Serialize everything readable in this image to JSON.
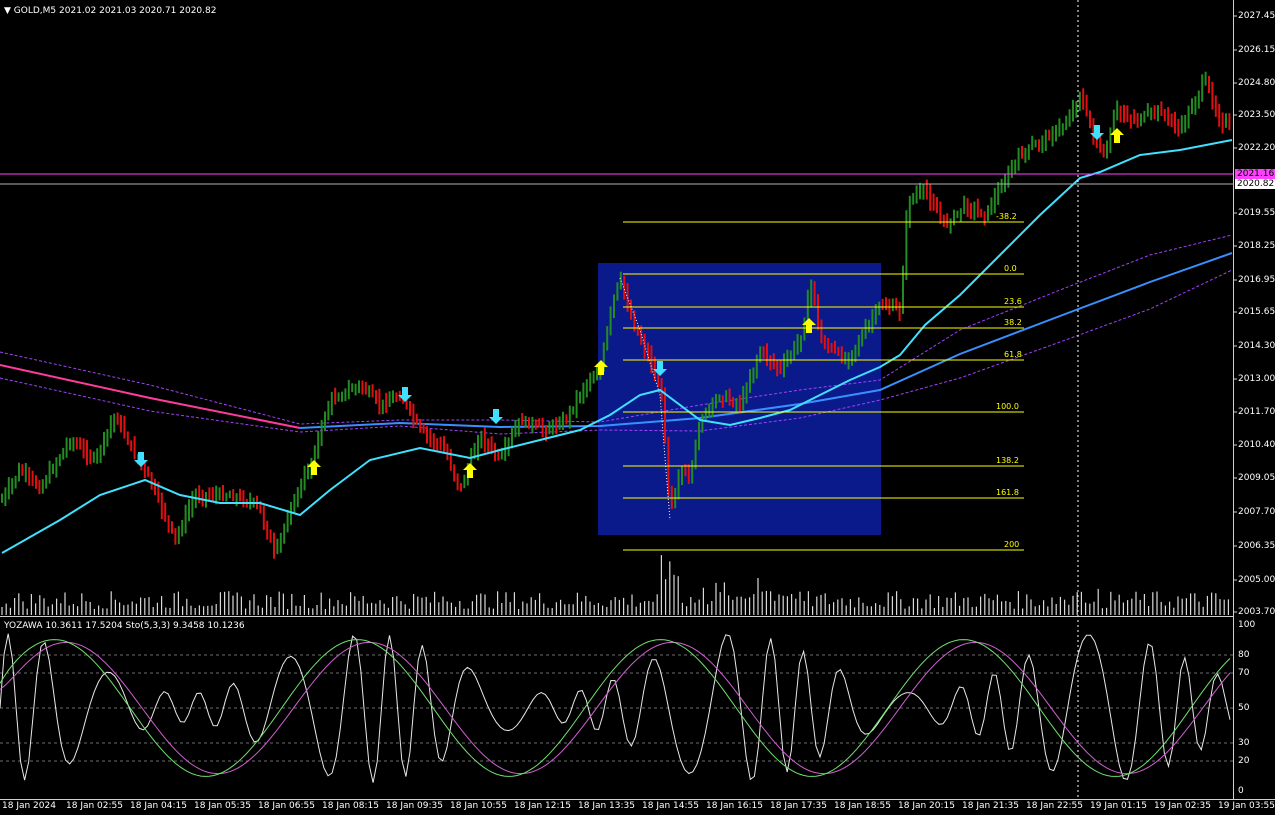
{
  "header": {
    "caret": "▼",
    "text": "GOLD,M5  2021.02 2021.03 2020.71 2020.82"
  },
  "indicator": {
    "text": "YOZAWA 10.3611 17.5204  Sto(5,3,3) 9.3458 10.1236"
  },
  "price_axis": {
    "labels": [
      "2027.45",
      "2026.15",
      "2024.80",
      "2023.50",
      "2022.20",
      "2019.55",
      "2018.25",
      "2016.95",
      "2015.65",
      "2014.30",
      "2013.00",
      "2011.70",
      "2010.40",
      "2009.05",
      "2007.70",
      "2006.35",
      "2005.00",
      "2003.70"
    ],
    "tag_magenta": "2021.16",
    "tag_current": "2020.82"
  },
  "indicator_axis": {
    "labels": [
      "100",
      "80",
      "70",
      "50",
      "30",
      "20",
      "0"
    ]
  },
  "time_axis": {
    "labels": [
      "18 Jan 2024",
      "18 Jan 02:55",
      "18 Jan 04:15",
      "18 Jan 05:35",
      "18 Jan 06:55",
      "18 Jan 08:15",
      "18 Jan 09:35",
      "18 Jan 10:55",
      "18 Jan 12:15",
      "18 Jan 13:35",
      "18 Jan 14:55",
      "18 Jan 16:15",
      "18 Jan 17:35",
      "18 Jan 18:55",
      "18 Jan 20:15",
      "18 Jan 21:35",
      "18 Jan 22:55",
      "19 Jan 01:15",
      "19 Jan 02:35",
      "19 Jan 03:55"
    ]
  },
  "fibonacci": {
    "levels": [
      "-38.2",
      "0.0",
      "23.6",
      "38.2",
      "61.8",
      "100.0",
      "138.2",
      "161.8",
      "200"
    ]
  },
  "colors": {
    "background": "#000000",
    "bull": "#228b22",
    "bear": "#e01010",
    "fast_ma": "#40e0ff",
    "slow_ma": "#3a8fff",
    "pink_ma": "#ff3c9c",
    "envelope": "#a040ff",
    "fib": "#ffff00",
    "box": "#0a1a8a",
    "magenta_line": "#ff40ff"
  }
}
